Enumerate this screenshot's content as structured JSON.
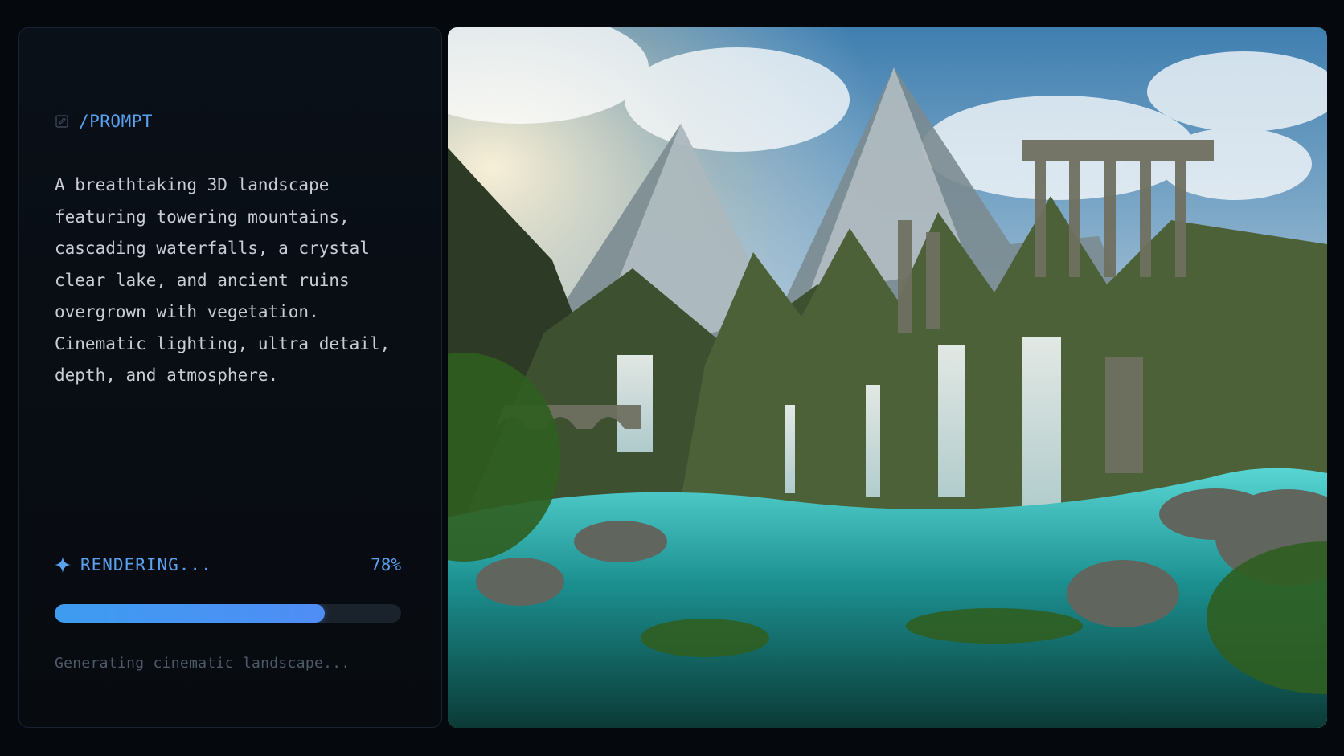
{
  "prompt": {
    "icon": "edit-icon",
    "label": "/PROMPT",
    "text": "A breathtaking 3D landscape\nfeaturing towering mountains,\ncascading waterfalls, a crystal\nclear lake, and ancient ruins\novergrown with vegetation.\nCinematic lighting, ultra detail,\ndepth, and atmosphere."
  },
  "render": {
    "icon": "sparkle-icon",
    "status_label": "RENDERING...",
    "progress": 0.78,
    "progress_label": "78%",
    "subtext": "Generating cinematic landscape...",
    "image_subject": "cinematic landscape with mountains, waterfalls, lake and ancient ruins"
  },
  "colors": {
    "background": "#05080c",
    "panel": "#0a1018",
    "accent": "#5aa2f0",
    "text": "#c9ced6",
    "muted": "#4e5a68",
    "progress_fill": "#4f8df5",
    "progress_track": "#1a222c"
  }
}
